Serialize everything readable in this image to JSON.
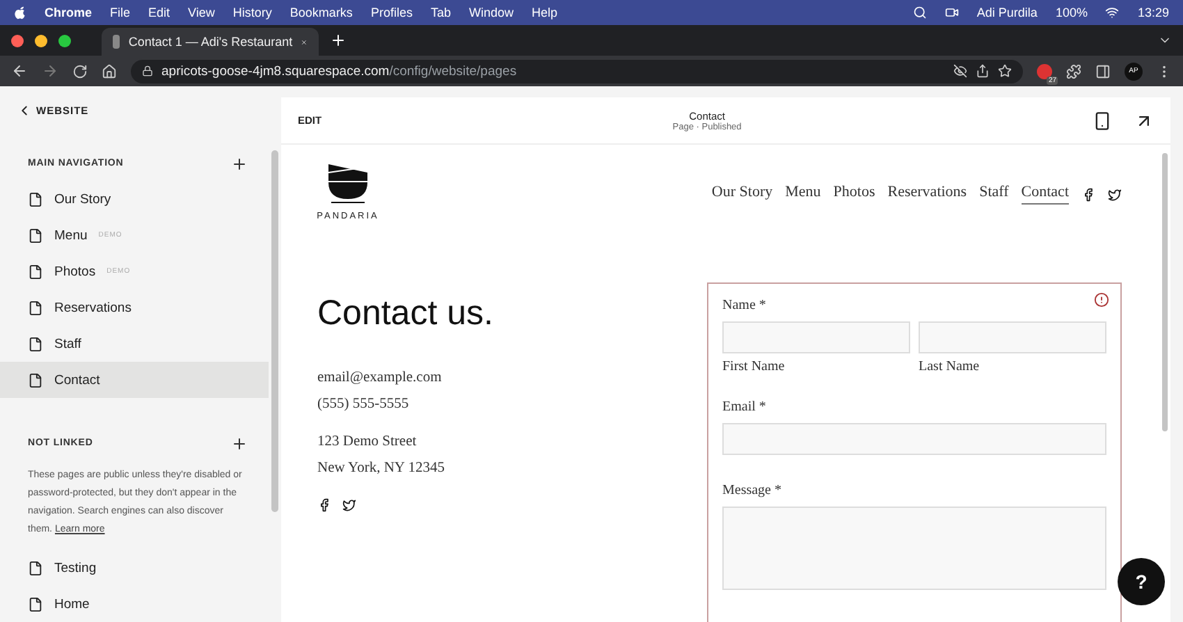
{
  "menubar": {
    "app": "Chrome",
    "items": [
      "File",
      "Edit",
      "View",
      "History",
      "Bookmarks",
      "Profiles",
      "Tab",
      "Window",
      "Help"
    ],
    "user": "Adi Purdila",
    "battery": "100%",
    "time": "13:29"
  },
  "browser": {
    "tab_title": "Contact 1 — Adi's Restaurant",
    "url_host": "apricots-goose-4jm8.squarespace.com",
    "url_path": "/config/website/pages",
    "extension_badge": "27",
    "profile": "AP"
  },
  "sidebar": {
    "back_label": "WEBSITE",
    "sections": [
      {
        "title": "MAIN NAVIGATION",
        "items": [
          {
            "label": "Our Story",
            "selected": false
          },
          {
            "label": "Menu",
            "tag": "DEMO",
            "selected": false
          },
          {
            "label": "Photos",
            "tag": "DEMO",
            "selected": false
          },
          {
            "label": "Reservations",
            "selected": false
          },
          {
            "label": "Staff",
            "selected": false
          },
          {
            "label": "Contact",
            "selected": true
          }
        ]
      },
      {
        "title": "NOT LINKED",
        "description": "These pages are public unless they're disabled or password-protected, but they don't appear in the navigation. Search engines can also discover them.",
        "link": "Learn more",
        "items": [
          {
            "label": "Testing",
            "selected": false
          },
          {
            "label": "Home",
            "selected": false
          }
        ]
      }
    ]
  },
  "editor": {
    "edit_label": "EDIT",
    "page_title": "Contact",
    "page_status": "Page · Published"
  },
  "site": {
    "logo_text": "PANDARIA",
    "nav": [
      {
        "label": "Our Story",
        "selected": false
      },
      {
        "label": "Menu",
        "selected": false
      },
      {
        "label": "Photos",
        "selected": false
      },
      {
        "label": "Reservations",
        "selected": false
      },
      {
        "label": "Staff",
        "selected": false
      },
      {
        "label": "Contact",
        "selected": true
      }
    ],
    "heading": "Contact us.",
    "email": "email@example.com",
    "phone": "(555) 555-5555",
    "address_1": "123 Demo Street",
    "address_2": "New York, NY 12345",
    "form": {
      "error": true,
      "name_label": "Name *",
      "first_name": "First Name",
      "last_name": "Last Name",
      "email_label": "Email *",
      "message_label": "Message *"
    }
  },
  "help_button": "?"
}
